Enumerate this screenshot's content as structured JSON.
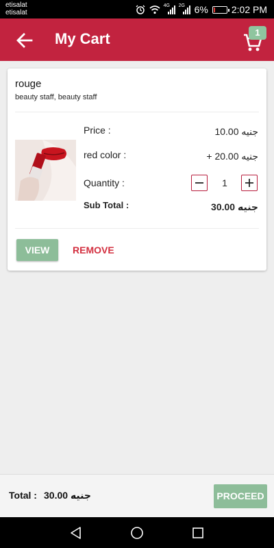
{
  "status_bar": {
    "carrier_1": "etisalat",
    "carrier_2": "etisalat",
    "signal_1_tag": "4G",
    "signal_2_tag": "2G",
    "battery": "6%",
    "time": "2:02 PM"
  },
  "app_bar": {
    "title": "My Cart",
    "cart_badge": "1",
    "color": "#c2233f"
  },
  "cart_item": {
    "name": "rouge",
    "category": "beauty staff, beauty staff",
    "price_label": "Price :",
    "price_value": "10.00 جنيه",
    "option_label": "red color :",
    "option_value": "+ 20.00 جنيه",
    "quantity_label": "Quantity :",
    "quantity_value": "1",
    "subtotal_label": "Sub Total :",
    "subtotal_value": "30.00 جنيه",
    "view_label": "VIEW",
    "remove_label": "REMOVE"
  },
  "footer": {
    "total_label": "Total :",
    "total_value": "30.00 جنيه",
    "proceed_label": "PROCEED"
  },
  "colors": {
    "accent_red": "#c2233f",
    "button_green": "#8dbd99",
    "remove_red": "#d32f3f"
  }
}
